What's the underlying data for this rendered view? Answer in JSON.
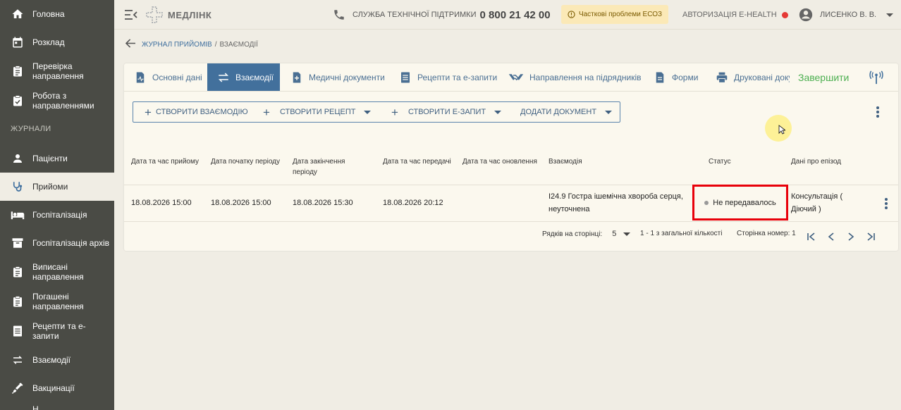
{
  "sidebar": {
    "items": [
      {
        "label": "Головна",
        "icon": "home-icon"
      },
      {
        "label": "Розклад",
        "icon": "calendar-icon"
      },
      {
        "label": "Перевірка направлення",
        "icon": "clipboard-icon"
      },
      {
        "label": "Робота з направленнями",
        "icon": "clipboard-check-icon"
      },
      {
        "label": "Пацієнти",
        "icon": "person-icon"
      },
      {
        "label": "Прийоми",
        "icon": "stethoscope-icon"
      },
      {
        "label": "Госпіталізація",
        "icon": "bed-icon"
      },
      {
        "label": "Госпіталізація архів",
        "icon": "archive-icon"
      },
      {
        "label": "Виписані направлення",
        "icon": "clipboard-icon"
      },
      {
        "label": "Погашені направлення",
        "icon": "clipboard-icon"
      },
      {
        "label": "Рецепти та е-запити",
        "icon": "list-icon"
      },
      {
        "label": "Взаємодії",
        "icon": "swap-icon"
      },
      {
        "label": "Вакцинації",
        "icon": "syringe-icon"
      },
      {
        "label": "Н...",
        "icon": "more-icon"
      }
    ],
    "section_label": "ЖУРНАЛИ"
  },
  "topbar": {
    "logo": "МЕДЛІНК",
    "support_label": "СЛУЖБА ТЕХНІЧНОЇ ПІДТРИМКИ",
    "support_number": "0 800 21 42 00",
    "warning": "Часткові проблеми ЕСОЗ",
    "auth": "АВТОРИЗАЦІЯ E-HEALTH",
    "user": "ЛИСЕНКО В. В."
  },
  "breadcrumb": {
    "link": "ЖУРНАЛ ПРИЙОМІВ",
    "separator": "/",
    "current": "ВЗАЄМОДІЇ"
  },
  "tabs": [
    {
      "label": "Основні дані",
      "icon": "chart-doc-icon"
    },
    {
      "label": "Взаємодії",
      "icon": "swap-icon"
    },
    {
      "label": "Медичні документи",
      "icon": "doc-plus-icon"
    },
    {
      "label": "Рецепти та е-запити",
      "icon": "list-icon"
    },
    {
      "label": "Направлення на підрядників",
      "icon": "handshake-icon"
    },
    {
      "label": "Форми",
      "icon": "doc-icon"
    },
    {
      "label": "Друковані доку",
      "icon": "print-icon"
    }
  ],
  "finish_label": "Завершити",
  "actions": {
    "create_interaction": "СТВОРИТИ ВЗАЄМОДІЮ",
    "create_recipe": "СТВОРИТИ РЕЦЕПТ",
    "create_request": "СТВОРИТИ Е-ЗАПИТ",
    "add_document": "ДОДАТИ ДОКУМЕНТ"
  },
  "table": {
    "headers": [
      "Дата та час прийому",
      "Дата початку періоду",
      "Дата закінчення періоду",
      "Дата та час передачі",
      "Дата та час оновлення",
      "Взаємодія",
      "Статус",
      "Дані про епізод"
    ],
    "rows": [
      {
        "visit": "18.08.2026 15:00",
        "period_start": "18.08.2026 15:00",
        "period_end": "18.08.2026 15:30",
        "sent": "18.08.2026 20:12",
        "updated": "",
        "interaction": "I24.9 Гостра ішемічна хвороба серця, неуточнена",
        "status": "Не передавалось",
        "episode": "Консультація ( Діючий )"
      }
    ]
  },
  "pager": {
    "rows_per_page_label": "Рядків на сторінці:",
    "rows_per_page": "5",
    "range": "1 - 1 з загальної кількості",
    "page": "Сторінка номер: 1"
  },
  "colors": {
    "sidebar_bg": "#4a4b45",
    "accent": "#42709c",
    "finish": "#4caf50",
    "highlight": "#e8000a",
    "warning_bg": "#fbe9b7"
  }
}
